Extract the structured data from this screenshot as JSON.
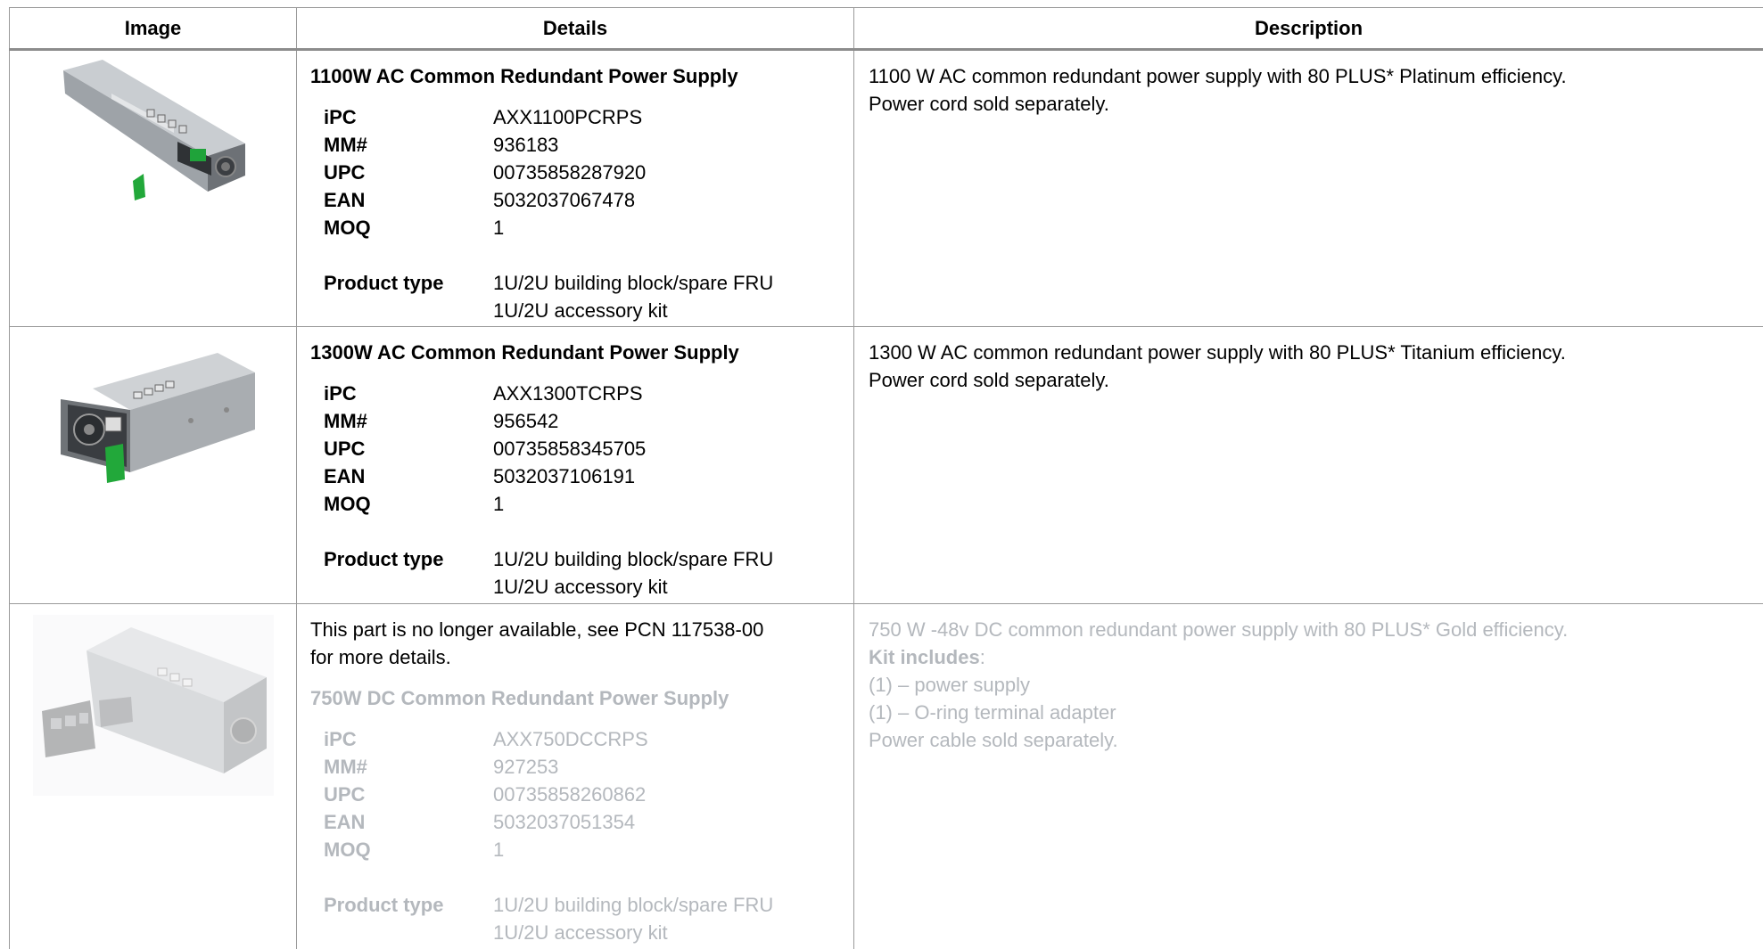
{
  "table": {
    "headers": [
      "Image",
      "Details",
      "Description"
    ],
    "rows": [
      {
        "title": "1100W AC Common Redundant Power Supply",
        "specs": [
          {
            "key": "iPC",
            "value": "AXX1100PCRPS"
          },
          {
            "key": "MM#",
            "value": "936183"
          },
          {
            "key": "UPC",
            "value": "00735858287920"
          },
          {
            "key": "EAN",
            "value": "5032037067478"
          },
          {
            "key": "MOQ",
            "value": "1"
          }
        ],
        "product_type_label": "Product type",
        "product_type": [
          "1U/2U building block/spare FRU",
          "1U/2U accessory kit"
        ],
        "description": [
          "1100 W AC common redundant power supply with 80 PLUS* Platinum efficiency.",
          "Power cord sold separately."
        ]
      },
      {
        "title": "1300W AC Common Redundant Power Supply",
        "specs": [
          {
            "key": "iPC",
            "value": "AXX1300TCRPS"
          },
          {
            "key": "MM#",
            "value": "956542"
          },
          {
            "key": "UPC",
            "value": "00735858345705"
          },
          {
            "key": "EAN",
            "value": "5032037106191"
          },
          {
            "key": "MOQ",
            "value": "1"
          }
        ],
        "product_type_label": "Product type",
        "product_type": [
          "1U/2U building block/spare FRU",
          "1U/2U accessory kit"
        ],
        "description": [
          "1300 W AC common redundant power supply with 80 PLUS* Titanium efficiency.",
          "Power cord sold separately."
        ]
      },
      {
        "notice": [
          "This part is no longer available, see PCN 117538-00",
          "for more details."
        ],
        "title": "750W DC Common Redundant Power Supply",
        "specs": [
          {
            "key": "iPC",
            "value": "AXX750DCCRPS"
          },
          {
            "key": "MM#",
            "value": "927253"
          },
          {
            "key": "UPC",
            "value": "00735858260862"
          },
          {
            "key": "EAN",
            "value": "5032037051354"
          },
          {
            "key": "MOQ",
            "value": "1"
          }
        ],
        "product_type_label": "Product type",
        "product_type": [
          "1U/2U building block/spare FRU",
          "1U/2U accessory kit"
        ],
        "description_first": "750 W -48v DC common redundant power supply with 80 PLUS* Gold efficiency.",
        "kit_label": "Kit includes",
        "kit_colon": ":",
        "kit_items": [
          "(1) – power supply",
          "(1) – O-ring terminal adapter"
        ],
        "description_last": "Power cable sold separately."
      }
    ]
  },
  "colors": {
    "text": "#000000",
    "faded_text": "#b4b8bd",
    "border": "#9a9a9a",
    "psu_green_handle": "#22a83a"
  },
  "icons": {
    "row1_image": "power-supply-photo",
    "row2_image": "power-supply-photo",
    "row3_image": "power-supply-with-terminal-adapter-photo"
  }
}
